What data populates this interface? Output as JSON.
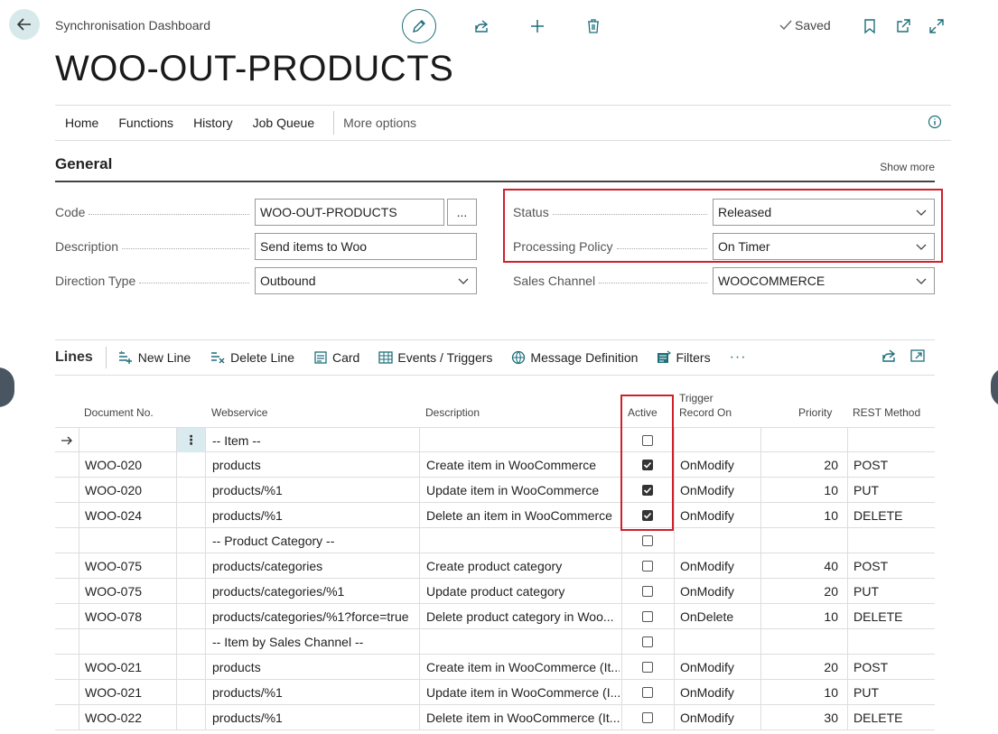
{
  "header": {
    "caption": "Synchronisation Dashboard",
    "title": "WOO-OUT-PRODUCTS",
    "saved": "Saved"
  },
  "menu": {
    "items": [
      "Home",
      "Functions",
      "History",
      "Job Queue"
    ],
    "more": "More options"
  },
  "general": {
    "title": "General",
    "show_more": "Show more",
    "code_label": "Code",
    "code_value": "WOO-OUT-PRODUCTS",
    "assist": "...",
    "description_label": "Description",
    "description_value": "Send items to Woo",
    "direction_label": "Direction Type",
    "direction_value": "Outbound",
    "status_label": "Status",
    "status_value": "Released",
    "policy_label": "Processing Policy",
    "policy_value": "On Timer",
    "channel_label": "Sales Channel",
    "channel_value": "WOOCOMMERCE"
  },
  "lines": {
    "title": "Lines",
    "actions": [
      "New Line",
      "Delete Line",
      "Card",
      "Events / Triggers",
      "Message Definition",
      "Filters"
    ],
    "more": "···",
    "columns": {
      "doc": "Document No.",
      "webservice": "Webservice",
      "description": "Description",
      "active": "Active",
      "trigger_1": "Trigger",
      "trigger_2": "Record On",
      "priority": "Priority",
      "rest": "REST Method"
    },
    "rows": [
      {
        "doc": "",
        "webservice": "-- Item --",
        "description": "",
        "active": false,
        "trigger": "",
        "priority": "",
        "rest": ""
      },
      {
        "doc": "WOO-020",
        "webservice": "products",
        "description": "Create item in WooCommerce",
        "active": true,
        "trigger": "OnModify",
        "priority": "20",
        "rest": "POST"
      },
      {
        "doc": "WOO-020",
        "webservice": "products/%1",
        "description": "Update item in WooCommerce",
        "active": true,
        "trigger": "OnModify",
        "priority": "10",
        "rest": "PUT"
      },
      {
        "doc": "WOO-024",
        "webservice": "products/%1",
        "description": "Delete an item in WooCommerce",
        "active": true,
        "trigger": "OnModify",
        "priority": "10",
        "rest": "DELETE"
      },
      {
        "doc": "",
        "webservice": "-- Product Category --",
        "description": "",
        "active": false,
        "trigger": "",
        "priority": "",
        "rest": ""
      },
      {
        "doc": "WOO-075",
        "webservice": "products/categories",
        "description": "Create product category",
        "active": false,
        "trigger": "OnModify",
        "priority": "40",
        "rest": "POST"
      },
      {
        "doc": "WOO-075",
        "webservice": "products/categories/%1",
        "description": "Update product category",
        "active": false,
        "trigger": "OnModify",
        "priority": "20",
        "rest": "PUT"
      },
      {
        "doc": "WOO-078",
        "webservice": "products/categories/%1?force=true",
        "description": "Delete product category in Woo...",
        "active": false,
        "trigger": "OnDelete",
        "priority": "10",
        "rest": "DELETE"
      },
      {
        "doc": "",
        "webservice": "-- Item by Sales Channel --",
        "description": "",
        "active": false,
        "trigger": "",
        "priority": "",
        "rest": ""
      },
      {
        "doc": "WOO-021",
        "webservice": "products",
        "description": "Create item in WooCommerce (It...",
        "active": false,
        "trigger": "OnModify",
        "priority": "20",
        "rest": "POST"
      },
      {
        "doc": "WOO-021",
        "webservice": "products/%1",
        "description": "Update item in WooCommerce (I...",
        "active": false,
        "trigger": "OnModify",
        "priority": "10",
        "rest": "PUT"
      },
      {
        "doc": "WOO-022",
        "webservice": "products/%1",
        "description": "Delete item in WooCommerce (It...",
        "active": false,
        "trigger": "OnModify",
        "priority": "30",
        "rest": "DELETE"
      }
    ]
  },
  "colors": {
    "accent": "#1d6f7a",
    "highlight": "#d0202a"
  },
  "icons": [
    "back-arrow-icon",
    "pencil-icon",
    "share-icon",
    "plus-icon",
    "trash-icon",
    "check-icon",
    "bookmark-icon",
    "open-new-window-icon",
    "expand-icon",
    "info-icon"
  ]
}
